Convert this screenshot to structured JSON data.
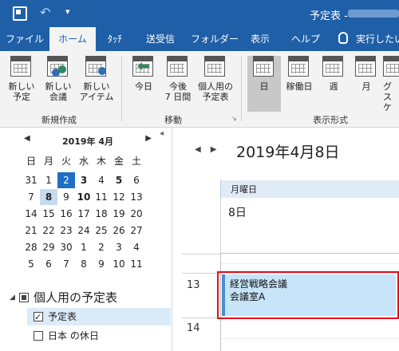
{
  "titlebar": {
    "title": "予定表 -"
  },
  "tabs": [
    {
      "label": "ファイル"
    },
    {
      "label": "ホーム"
    },
    {
      "label": "ﾀｯﾁ"
    },
    {
      "label": "送受信"
    },
    {
      "label": "フォルダー"
    },
    {
      "label": "表示"
    },
    {
      "label": "ヘルプ"
    },
    {
      "label": "実行したい"
    }
  ],
  "ribbon": {
    "new": {
      "appt": "新しい\n予定",
      "meeting": "新しい\n会議",
      "items": "新しい\nアイテム",
      "group": "新規作成"
    },
    "goto": {
      "today": "今日",
      "next7": "今後\n7 日間",
      "personal": "個人用の\n予定表",
      "group": "移動"
    },
    "view": {
      "day": "日",
      "workweek": "稼働日",
      "week": "週",
      "month": "月",
      "schedule": "グ\nスケ",
      "group": "表示形式"
    }
  },
  "mini_calendar": {
    "title": "2019年 4月",
    "weekdays": [
      "日",
      "月",
      "火",
      "水",
      "木",
      "金",
      "土"
    ],
    "weeks": [
      [
        "31",
        "1",
        "2",
        "3",
        "4",
        "5",
        "6"
      ],
      [
        "7",
        "8",
        "9",
        "10",
        "11",
        "12",
        "13"
      ],
      [
        "14",
        "15",
        "16",
        "17",
        "18",
        "19",
        "20"
      ],
      [
        "21",
        "22",
        "23",
        "24",
        "25",
        "26",
        "27"
      ],
      [
        "28",
        "29",
        "30",
        "1",
        "2",
        "3",
        "4"
      ],
      [
        "5",
        "6",
        "7",
        "8",
        "9",
        "10",
        "11"
      ]
    ],
    "today": "2",
    "selected": "8"
  },
  "folders": {
    "header": "個人用の予定表",
    "items": [
      {
        "label": "予定表",
        "checked": true
      },
      {
        "label": "日本 の休日",
        "checked": false
      }
    ]
  },
  "day_view": {
    "title": "2019年4月8日",
    "weekday": "月曜日",
    "day_number": "8日",
    "hours": [
      "13",
      "14"
    ],
    "event": {
      "subject": "経営戦略会議",
      "location": "会議室A"
    }
  }
}
